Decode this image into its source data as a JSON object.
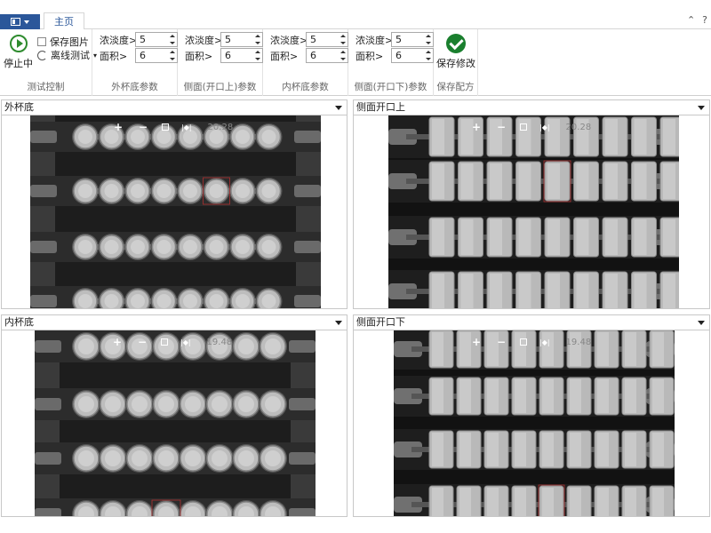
{
  "tabs": {
    "home": "主页"
  },
  "ribbon": {
    "test_control": {
      "title": "测试控制",
      "stop_label": "停止中",
      "save_image_label": "保存图片",
      "offline_test_label": "离线测试"
    },
    "outer_bottom": {
      "title": "外杯底参数",
      "density_label": "浓淡度>",
      "density_value": "5",
      "area_label": "面积>",
      "area_value": "6"
    },
    "side_top": {
      "title": "侧面(开口上)参数",
      "density_label": "浓淡度>",
      "density_value": "5",
      "area_label": "面积>",
      "area_value": "6"
    },
    "inner_bottom": {
      "title": "内杯底参数",
      "density_label": "浓淡度>",
      "density_value": "5",
      "area_label": "面积>",
      "area_value": "6"
    },
    "side_bottom": {
      "title": "侧面(开口下)参数",
      "density_label": "浓淡度>",
      "density_value": "5",
      "area_label": "面积>",
      "area_value": "6"
    },
    "save_recipe": {
      "title": "保存配方",
      "save_label": "保存修改"
    }
  },
  "panels": {
    "outer_bottom": {
      "title": "外杯底",
      "zoom": "20.28"
    },
    "side_top": {
      "title": "侧面开口上",
      "zoom": "20.28"
    },
    "inner_bottom": {
      "title": "内杯底",
      "zoom": "19.48"
    },
    "side_bottom": {
      "title": "侧面开口下",
      "zoom": "19.48"
    }
  },
  "toolbar": {
    "zoom_in": "+",
    "zoom_out": "−"
  },
  "colors": {
    "accent": "#2b579a",
    "run_green": "#2e8b2e",
    "save_green": "#1a7f2e",
    "highlight": "#b03030"
  }
}
